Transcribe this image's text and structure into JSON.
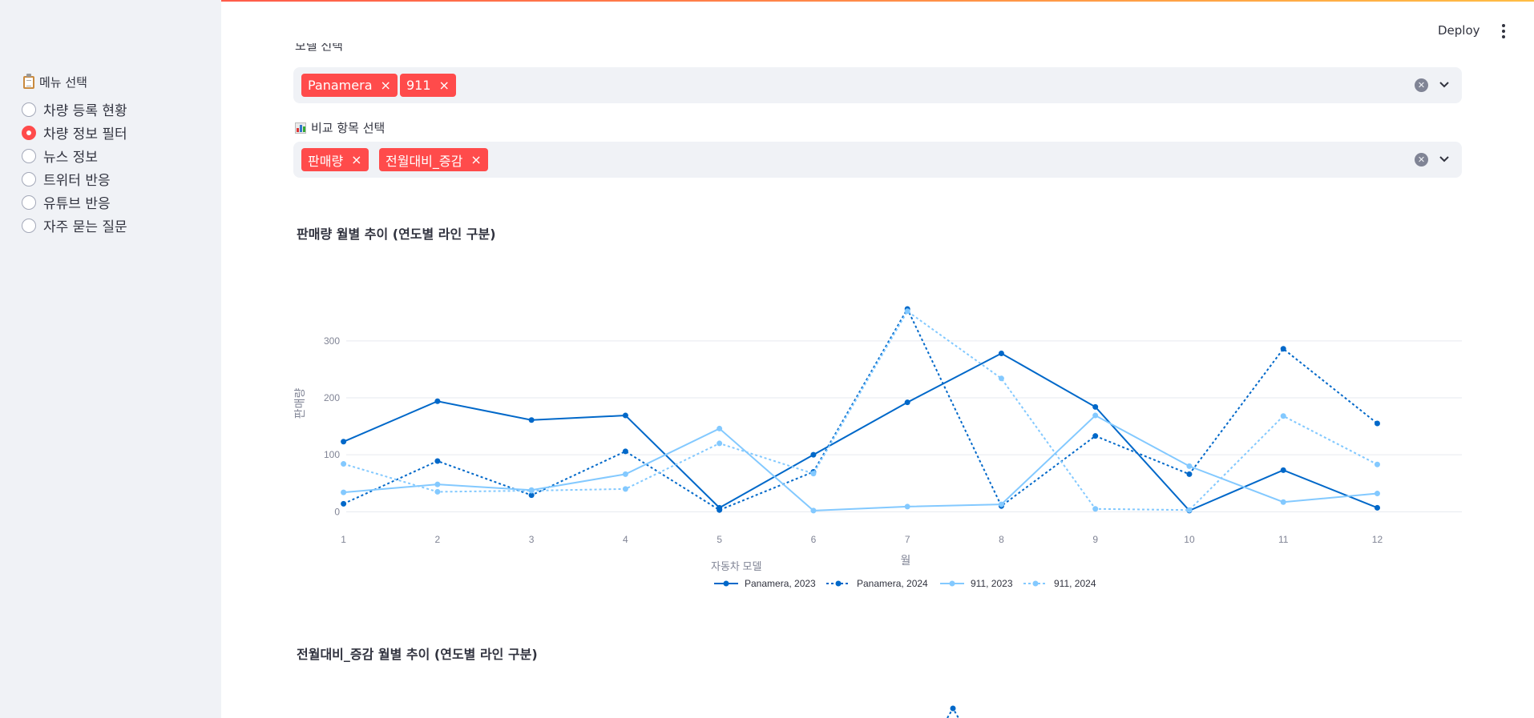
{
  "header": {
    "deploy_label": "Deploy",
    "menu_icon": "kebab-menu-icon"
  },
  "sidebar": {
    "title": "메뉴 선택",
    "title_icon": "clipboard-icon",
    "items": [
      {
        "label": "차량 등록 현황",
        "selected": false
      },
      {
        "label": "차량 정보 필터",
        "selected": true
      },
      {
        "label": "뉴스 정보",
        "selected": false
      },
      {
        "label": "트위터 반응",
        "selected": false
      },
      {
        "label": "유튜브 반응",
        "selected": false
      },
      {
        "label": "자주 묻는 질문",
        "selected": false
      }
    ]
  },
  "model_select": {
    "label": "모델 선택",
    "tags": [
      "Panamera",
      "911"
    ]
  },
  "metric_select": {
    "label": "비교 항목 선택",
    "icon": "bar-chart-icon",
    "tags": [
      "판매량",
      "전월대비_증감"
    ]
  },
  "section1_title": "판매량 월별 추이 (연도별 라인 구분)",
  "section2_title": "전월대비_증감 월별 추이 (연도별 라인 구분)",
  "colors": {
    "accent": "#ff4b4b",
    "dark_blue": "#0068c9",
    "light_blue": "#83c9ff",
    "sidebar_bg": "#f0f2f6"
  },
  "chart_data": {
    "type": "line",
    "xlabel": "월",
    "ylabel": "판매량",
    "legend_title": "자동차 모델",
    "legend_position": "bottom",
    "x": [
      1,
      2,
      3,
      4,
      5,
      6,
      7,
      8,
      9,
      10,
      11,
      12
    ],
    "yticks": [
      0,
      100,
      200,
      300
    ],
    "ylim": [
      -15,
      370
    ],
    "grid": true,
    "series": [
      {
        "name": "Panamera, 2023",
        "color": "#0068c9",
        "dash": false,
        "values": [
          123,
          194,
          161,
          169,
          7,
          100,
          192,
          278,
          184,
          2,
          73,
          7
        ]
      },
      {
        "name": "Panamera, 2024",
        "color": "#0068c9",
        "dash": true,
        "values": [
          14,
          89,
          29,
          106,
          3,
          70,
          356,
          10,
          133,
          66,
          286,
          155
        ]
      },
      {
        "name": "911, 2023",
        "color": "#83c9ff",
        "dash": false,
        "values": [
          34,
          48,
          38,
          66,
          146,
          2,
          9,
          13,
          169,
          80,
          17,
          32
        ]
      },
      {
        "name": "911, 2024",
        "color": "#83c9ff",
        "dash": true,
        "values": [
          84,
          35,
          37,
          40,
          120,
          67,
          352,
          234,
          5,
          3,
          168,
          83
        ]
      }
    ]
  }
}
